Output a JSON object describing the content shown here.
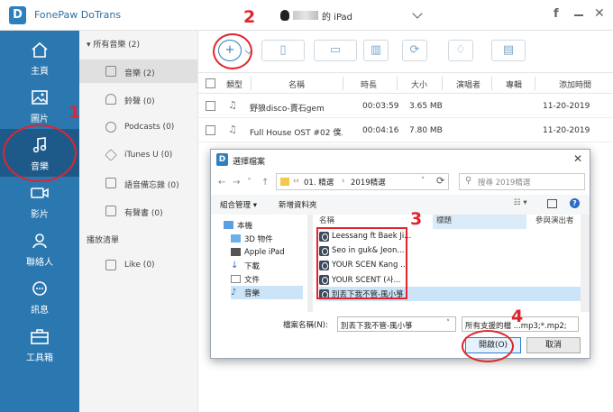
{
  "app": {
    "name": "FonePaw DoTrans",
    "logo_letter": "D",
    "device_name": "的 iPad",
    "fb_label": "f"
  },
  "sidebar": {
    "items": [
      {
        "label": "主頁",
        "icon": "home-icon"
      },
      {
        "label": "圖片",
        "icon": "picture-icon"
      },
      {
        "label": "音樂",
        "icon": "music-icon"
      },
      {
        "label": "影片",
        "icon": "video-icon"
      },
      {
        "label": "聯絡人",
        "icon": "contact-icon"
      },
      {
        "label": "訊息",
        "icon": "message-icon"
      },
      {
        "label": "工具箱",
        "icon": "toolbox-icon"
      }
    ],
    "active_index": 2
  },
  "panel": {
    "header": "所有音樂 (2)",
    "items": [
      {
        "label": "音樂 (2)",
        "icon": "music-note-icon"
      },
      {
        "label": "鈴聲 (0)",
        "icon": "bell-icon"
      },
      {
        "label": "Podcasts (0)",
        "icon": "podcast-icon"
      },
      {
        "label": "iTunes U (0)",
        "icon": "graduation-cap-icon"
      },
      {
        "label": "語音備忘錄 (0)",
        "icon": "voice-memo-icon"
      },
      {
        "label": "有聲書 (0)",
        "icon": "audiobook-icon"
      }
    ],
    "playlist_header": "播放清單",
    "playlist_items": [
      {
        "label": "Like (0)",
        "icon": "playlist-icon"
      }
    ]
  },
  "table": {
    "headers": [
      "類型",
      "名稱",
      "時長",
      "大小",
      "演唱者",
      "專輯",
      "添加時間"
    ],
    "rows": [
      {
        "name": "野狼disco-賣石gem",
        "duration": "00:03:59",
        "size": "3.65 MB",
        "artist": "",
        "album": "",
        "added": "11-20-2019"
      },
      {
        "name": "Full House OST #02 僕...",
        "duration": "00:04:16",
        "size": "7.80 MB",
        "artist": "",
        "album": "",
        "added": "11-20-2019"
      }
    ]
  },
  "dialog": {
    "title": "選擇檔案",
    "close": "✕",
    "path": [
      "01. 精選",
      "2019精選"
    ],
    "search_placeholder": "搜尋 2019精選",
    "organize": "組合管理 ▾",
    "new_folder": "新增資料夾",
    "tree": [
      "本機",
      "3D 物件",
      "Apple iPad",
      "下載",
      "文件",
      "音樂"
    ],
    "tree_selected": 5,
    "columns": {
      "name": "名稱",
      "title": "標題",
      "artist": "參與演出者"
    },
    "files": [
      "Leessang ft Baek Ji...",
      "Seo in guk& Jeon...",
      "YOUR SCEN Kang ...",
      "YOUR SCENT (사...",
      "別丟下我不管-風小箏"
    ],
    "file_selected": 4,
    "filename_label": "檔案名稱(N):",
    "filename_value": "別丟下我不管-風小箏",
    "filetype_value": "所有支援的檔 ...mp3;*.mp2;",
    "open_button": "開啟(O)",
    "cancel_button": "取消"
  },
  "annotations": {
    "step1": "1",
    "step2": "2",
    "step3": "3",
    "step4": "4",
    "color": "#e0262c"
  },
  "colors": {
    "sidebar": "#2b78b0",
    "sidebar_active": "#1d5a8a",
    "accent": "#2d7fbe"
  }
}
